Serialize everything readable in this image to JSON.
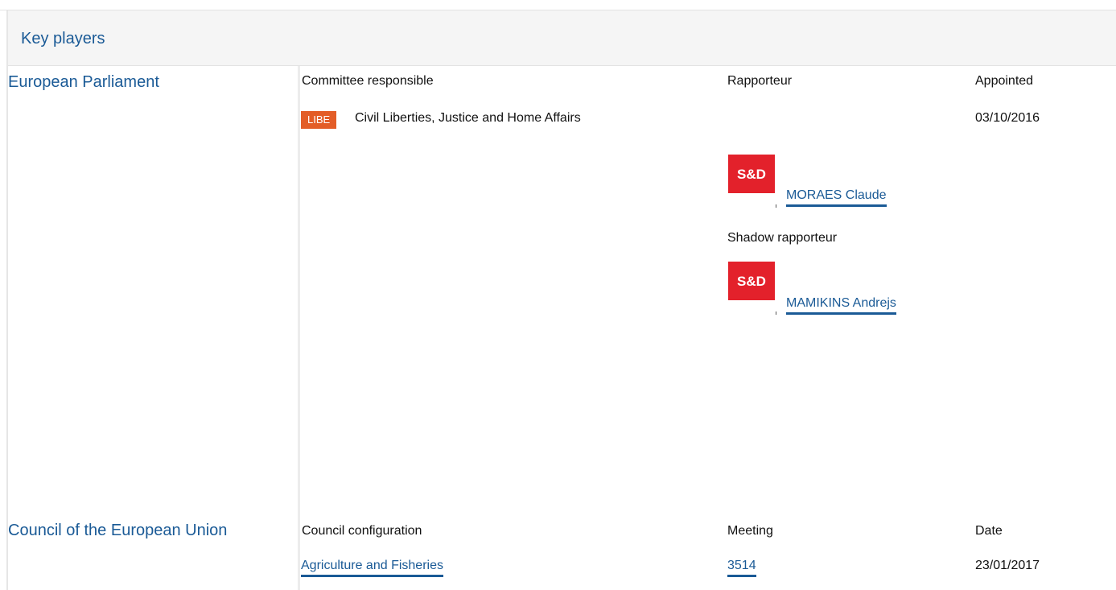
{
  "section": {
    "title": "Key players"
  },
  "parliament": {
    "label": "European Parliament",
    "col_committee": "Committee responsible",
    "col_rapporteur": "Rapporteur",
    "col_appointed": "Appointed",
    "committee": {
      "code": "LIBE",
      "name": "Civil Liberties, Justice and Home Affairs",
      "appointed": "03/10/2016"
    },
    "rapporteur": {
      "group_logo": "S&D",
      "name": "MORAES Claude"
    },
    "shadow_label": "Shadow rapporteur",
    "shadow": {
      "group_logo": "S&D",
      "name": "MAMIKINS Andrejs"
    }
  },
  "council": {
    "label": "Council of the European Union",
    "col_config": "Council configuration",
    "col_meeting": "Meeting",
    "col_date": "Date",
    "row": {
      "configuration": "Agriculture and Fisheries",
      "meeting": "3514",
      "date": "23/01/2017"
    }
  },
  "colors": {
    "link": "#1a5a96",
    "badge": "#e35d27",
    "sd_red": "#e3212b",
    "header_bg": "#f5f5f5"
  }
}
